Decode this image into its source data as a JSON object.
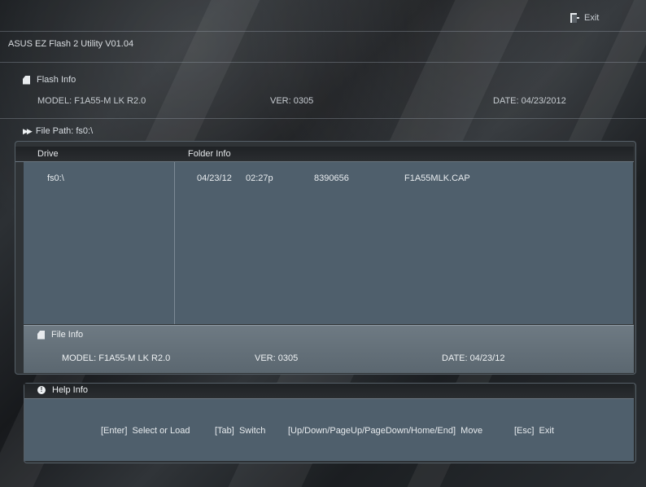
{
  "topbar": {
    "exit_label": "Exit",
    "exit_icon": "exit-door-icon"
  },
  "app": {
    "title": "ASUS EZ Flash 2 Utility V01.04"
  },
  "flash_info": {
    "title": "Flash Info",
    "model": "MODEL:  F1A55-M LK R2.0",
    "ver": "VER:  0305",
    "date": "DATE:  04/23/2012"
  },
  "file_path": {
    "label": "File Path:  fs0:\\"
  },
  "browser": {
    "drive_header": "Drive",
    "folder_header": "Folder Info",
    "drives": [
      "fs0:\\"
    ],
    "files": [
      {
        "date": "04/23/12",
        "time": "02:27p",
        "size": "8390656",
        "name": "F1A55MLK.CAP"
      }
    ]
  },
  "file_info": {
    "title": "File Info",
    "model": "MODEL: F1A55-M LK R2.0",
    "ver": "VER: 0305",
    "date": "DATE: 04/23/12"
  },
  "help": {
    "title": "Help Info",
    "items": [
      "[Enter]  Select or Load",
      "[Tab]  Switch",
      "[Up/Down/PageUp/PageDown/Home/End]  Move",
      "[Esc]  Exit"
    ]
  },
  "colors": {
    "panel": "#4f5f6c",
    "bar": "#6e7a83",
    "background": "#202326"
  }
}
